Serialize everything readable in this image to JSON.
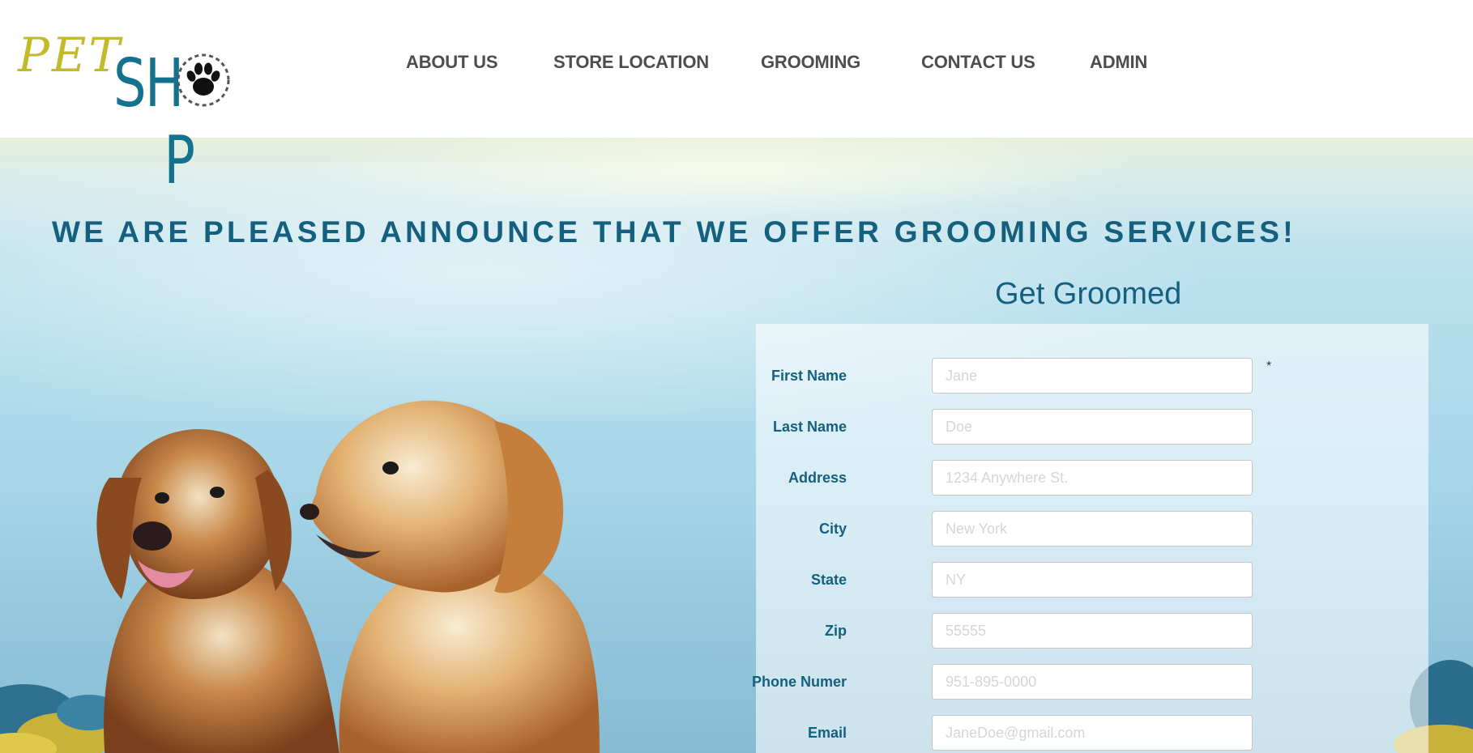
{
  "brand": {
    "logo_pet": "PET",
    "logo_shop_left": "SH",
    "logo_shop_right": "P"
  },
  "nav": {
    "items": [
      {
        "label": "ABOUT US"
      },
      {
        "label": "STORE LOCATION"
      },
      {
        "label": "GROOMING"
      },
      {
        "label": "CONTACT US"
      },
      {
        "label": "ADMIN"
      }
    ]
  },
  "hero": {
    "headline": "WE ARE PLEASED ANNOUNCE THAT WE OFFER GROOMING SERVICES!"
  },
  "form": {
    "title": "Get Groomed",
    "required_mark": "*",
    "fields": [
      {
        "label": "First Name",
        "placeholder": "Jane",
        "value": ""
      },
      {
        "label": "Last Name",
        "placeholder": "Doe",
        "value": ""
      },
      {
        "label": "Address",
        "placeholder": "1234 Anywhere St.",
        "value": ""
      },
      {
        "label": "City",
        "placeholder": "New York",
        "value": ""
      },
      {
        "label": "State",
        "placeholder": "NY",
        "value": ""
      },
      {
        "label": "Zip",
        "placeholder": "55555",
        "value": ""
      },
      {
        "label": "Phone Numer",
        "placeholder": "951-895-0000",
        "value": ""
      },
      {
        "label": "Email",
        "placeholder": "JaneDoe@gmail.com",
        "value": ""
      }
    ]
  },
  "icons": {
    "logo_mark": "paw-print-icon"
  },
  "colors": {
    "brand_blue": "#14728f",
    "brand_olive": "#c3ba2a",
    "heading_blue": "#14607e",
    "nav_text": "#4d4d4d"
  }
}
